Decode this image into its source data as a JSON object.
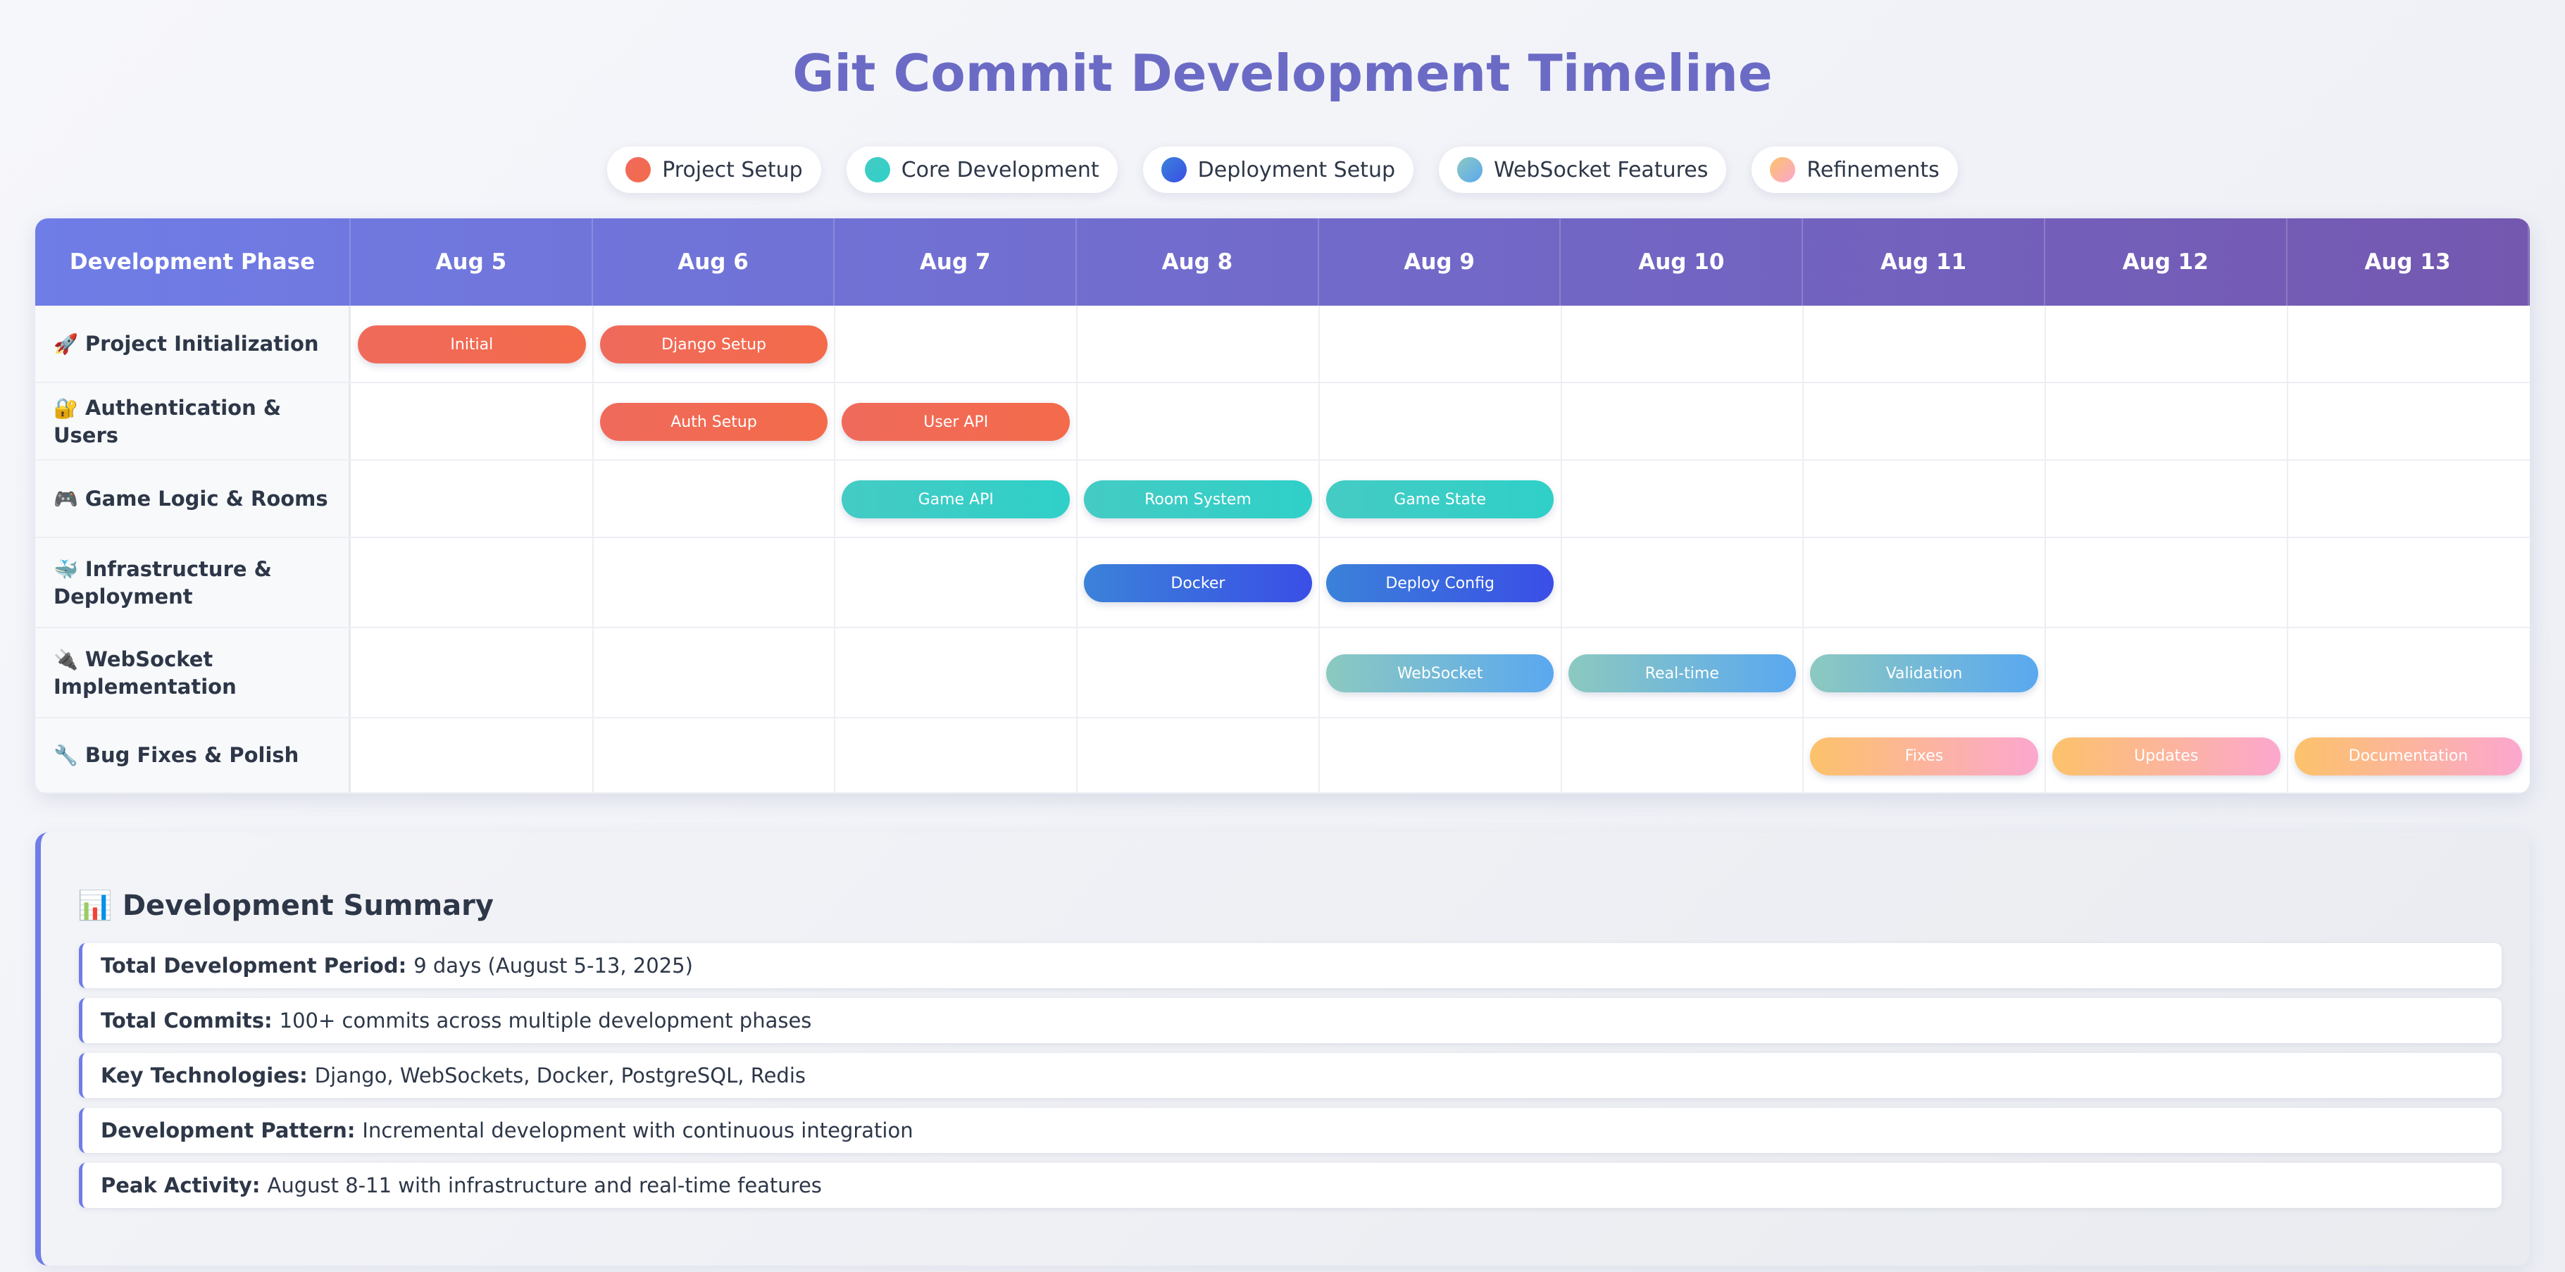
{
  "title": "Git Commit Development Timeline",
  "legend": [
    {
      "label": "Project Setup",
      "color_a": "#f06a5c",
      "color_b": "#f36b4a"
    },
    {
      "label": "Core Development",
      "color_a": "#44cbc4",
      "color_b": "#2fd0c8"
    },
    {
      "label": "Deployment Setup",
      "color_a": "#3b82d9",
      "color_b": "#3a4ee6"
    },
    {
      "label": "WebSocket Features",
      "color_a": "#8cc9c0",
      "color_b": "#5aa8f0"
    },
    {
      "label": "Refinements",
      "color_a": "#fcc26a",
      "color_b": "#fca7cf"
    }
  ],
  "header": {
    "phase_label": "Development Phase"
  },
  "chart_data": {
    "type": "table",
    "columns": [
      "Aug 5",
      "Aug 6",
      "Aug 7",
      "Aug 8",
      "Aug 9",
      "Aug 10",
      "Aug 11",
      "Aug 12",
      "Aug 13"
    ],
    "rows": [
      {
        "icon": "rocket-icon",
        "emoji": "🚀",
        "label": "Project Initialization"
      },
      {
        "icon": "lock-icon",
        "emoji": "🔐",
        "label": "Authentication & Users"
      },
      {
        "icon": "gamepad-icon",
        "emoji": "🎮",
        "label": "Game Logic & Rooms"
      },
      {
        "icon": "whale-icon",
        "emoji": "🐳",
        "label": "Infrastructure & Deployment"
      },
      {
        "icon": "plug-icon",
        "emoji": "🔌",
        "label": "WebSocket Implementation"
      },
      {
        "icon": "wrench-icon",
        "emoji": "🔧",
        "label": "Bug Fixes & Polish"
      }
    ],
    "bars": [
      {
        "row": 0,
        "col": 0,
        "label": "Initial",
        "category": 0
      },
      {
        "row": 0,
        "col": 1,
        "label": "Django Setup",
        "category": 0
      },
      {
        "row": 1,
        "col": 1,
        "label": "Auth Setup",
        "category": 0
      },
      {
        "row": 1,
        "col": 2,
        "label": "User API",
        "category": 0
      },
      {
        "row": 2,
        "col": 2,
        "label": "Game API",
        "category": 1
      },
      {
        "row": 2,
        "col": 3,
        "label": "Room System",
        "category": 1
      },
      {
        "row": 2,
        "col": 4,
        "label": "Game State",
        "category": 1
      },
      {
        "row": 3,
        "col": 3,
        "label": "Docker",
        "category": 2
      },
      {
        "row": 3,
        "col": 4,
        "label": "Deploy Config",
        "category": 2
      },
      {
        "row": 4,
        "col": 4,
        "label": "WebSocket",
        "category": 3
      },
      {
        "row": 4,
        "col": 5,
        "label": "Real-time",
        "category": 3
      },
      {
        "row": 4,
        "col": 6,
        "label": "Validation",
        "category": 3
      },
      {
        "row": 5,
        "col": 6,
        "label": "Fixes",
        "category": 4
      },
      {
        "row": 5,
        "col": 7,
        "label": "Updates",
        "category": 4
      },
      {
        "row": 5,
        "col": 8,
        "label": "Documentation",
        "category": 4
      }
    ]
  },
  "summary": {
    "icon": "bar-chart-icon",
    "emoji": "📊",
    "title": "Development Summary",
    "items": [
      {
        "label": "Total Development Period:",
        "value": "9 days (August 5-13, 2025)"
      },
      {
        "label": "Total Commits:",
        "value": "100+ commits across multiple development phases"
      },
      {
        "label": "Key Technologies:",
        "value": "Django, WebSockets, Docker, PostgreSQL, Redis"
      },
      {
        "label": "Development Pattern:",
        "value": "Incremental development with continuous integration"
      },
      {
        "label": "Peak Activity:",
        "value": "August 8-11 with infrastructure and real-time features"
      }
    ]
  }
}
